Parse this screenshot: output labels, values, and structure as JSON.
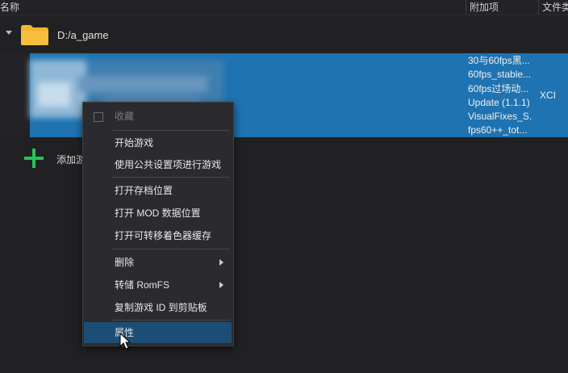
{
  "columns": {
    "name": "名称",
    "addons": "附加项",
    "file_type": "文件类"
  },
  "folder": {
    "path": "D:/a_game"
  },
  "game": {
    "addons": [
      "30与60fps黑...",
      "60fps_stable...",
      "60fps过场动...",
      "Update (1.1.1)",
      "VisualFixes_S...",
      "fps60++_tot..."
    ],
    "file_type": "XCI"
  },
  "add_dir": {
    "label": "添加游"
  },
  "context_menu": {
    "favorite": "收藏",
    "start_game": "开始游戏",
    "start_global_config": "使用公共设置项进行游戏",
    "open_save_location": "打开存档位置",
    "open_mod_location": "打开 MOD 数据位置",
    "open_shader_cache": "打开可转移着色器缓存",
    "remove": "删除",
    "dump_romfs": "转储 RomFS",
    "copy_title_id": "复制游戏 ID 到剪贴板",
    "properties": "属性"
  },
  "colors": {
    "selection": "#1f73b1",
    "folder": "#f5b32e",
    "plus": "#27c25a",
    "menu_hover": "#1c4d74"
  }
}
